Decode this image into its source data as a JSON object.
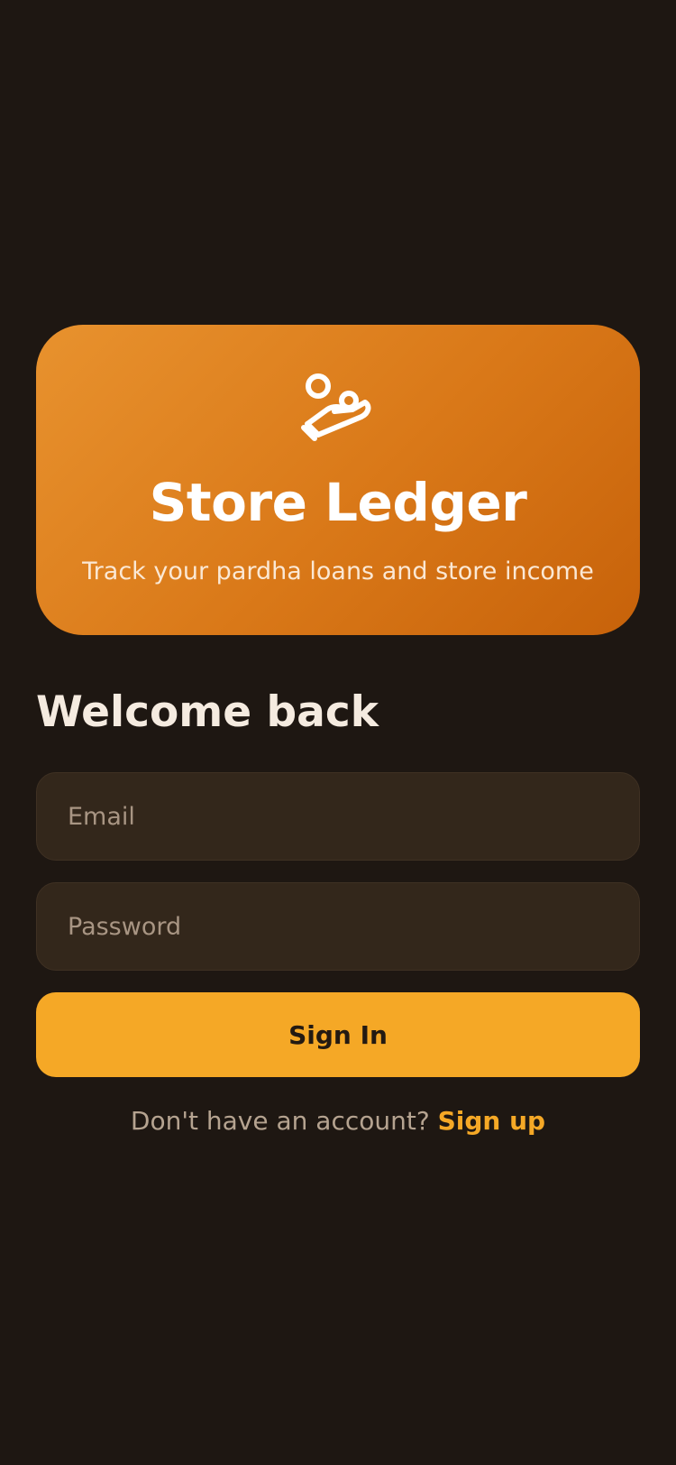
{
  "hero": {
    "icon": "hand-holding-coins-icon",
    "title": "Store Ledger",
    "subtitle": "Track your pardha loans and store income",
    "gradient_start": "#e8922e",
    "gradient_end": "#c7620a"
  },
  "login": {
    "heading": "Welcome back",
    "email": {
      "placeholder": "Email",
      "value": ""
    },
    "password": {
      "placeholder": "Password",
      "value": ""
    },
    "submit_label": "Sign In",
    "signup_prompt": "Don't have an account?",
    "signup_link": "Sign up"
  },
  "colors": {
    "background": "#1e1712",
    "accent": "#f5a826",
    "field_background": "#33271b"
  }
}
